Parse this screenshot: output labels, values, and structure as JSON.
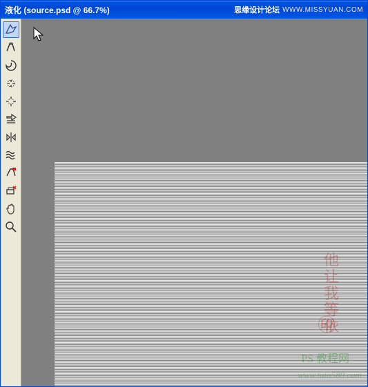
{
  "titlebar": {
    "title": "液化 (source.psd @ 66.7%)",
    "brand": "思缘设计论坛",
    "url": "WWW.MISSYUAN.COM"
  },
  "tools": [
    {
      "name": "forward-warp",
      "active": true
    },
    {
      "name": "reconstruct",
      "active": false
    },
    {
      "name": "twirl",
      "active": false
    },
    {
      "name": "pucker",
      "active": false
    },
    {
      "name": "bloat",
      "active": false
    },
    {
      "name": "push-left",
      "active": false
    },
    {
      "name": "mirror",
      "active": false
    },
    {
      "name": "turbulence",
      "active": false
    },
    {
      "name": "freeze-mask",
      "active": false
    },
    {
      "name": "thaw-mask",
      "active": false
    },
    {
      "name": "hand",
      "active": false
    },
    {
      "name": "zoom",
      "active": false
    }
  ],
  "watermarks": {
    "red_text": "他让我等依",
    "green_text": "PS 教程网",
    "green_url": "www.tata580.com"
  }
}
